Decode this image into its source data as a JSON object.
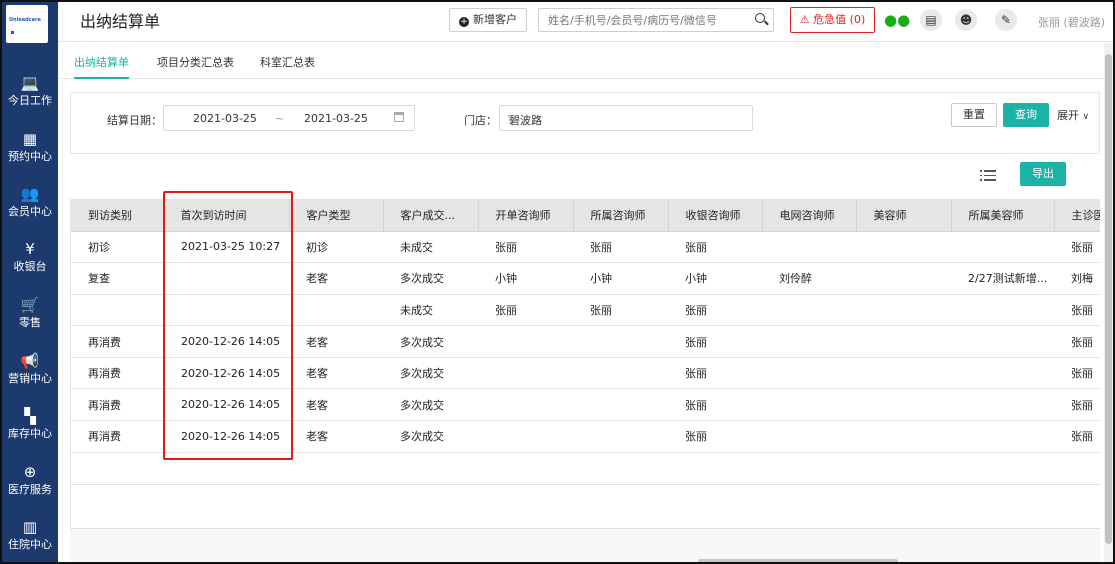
{
  "logo": {
    "text": "Unleadcare"
  },
  "sidebar": {
    "items": [
      {
        "label": "今日工作",
        "icon": "laptop-icon",
        "glyph": "💻"
      },
      {
        "label": "预约中心",
        "icon": "calendar-icon",
        "glyph": "▦"
      },
      {
        "label": "会员中心",
        "icon": "users-icon",
        "glyph": "👥"
      },
      {
        "label": "收银台",
        "icon": "yen-icon",
        "glyph": "¥"
      },
      {
        "label": "零售",
        "icon": "cart-icon",
        "glyph": "🛒"
      },
      {
        "label": "营销中心",
        "icon": "megaphone-icon",
        "glyph": "📢"
      },
      {
        "label": "库存中心",
        "icon": "grid-icon",
        "glyph": "▚"
      },
      {
        "label": "医疗服务",
        "icon": "medkit-icon",
        "glyph": "⊕"
      },
      {
        "label": "住院中心",
        "icon": "building-icon",
        "glyph": "▥"
      }
    ]
  },
  "header": {
    "title": "出纳结算单",
    "new_customer": "新增客户",
    "search_placeholder": "姓名/手机号/会员号/病历号/微信号",
    "danger_button": "危急值",
    "danger_count": "0",
    "user": "张丽 (碧波路)"
  },
  "tabs": [
    {
      "label": "出纳结算单",
      "active": true
    },
    {
      "label": "项目分类汇总表",
      "active": false
    },
    {
      "label": "科室汇总表",
      "active": false
    }
  ],
  "filters": {
    "date_label": "结算日期：",
    "date_start": "2021-03-25",
    "date_sep": "~",
    "date_end": "2021-03-25",
    "store_label": "门店：",
    "store_value": "碧波路",
    "reset": "重置",
    "query": "查询",
    "expand": "展开",
    "export": "导出"
  },
  "table": {
    "columns": [
      "到访类别",
      "首次到访时间",
      "客户类型",
      "客户成交...",
      "开单咨询师",
      "所属咨询师",
      "收银咨询师",
      "电网咨询师",
      "美容师",
      "所属美容师",
      "主诊医"
    ],
    "rows": [
      [
        "初诊",
        "2021-03-25 10:27",
        "初诊",
        "未成交",
        "张丽",
        "张丽",
        "张丽",
        "",
        "",
        "",
        "张丽"
      ],
      [
        "复查",
        "",
        "老客",
        "多次成交",
        "小钟",
        "小钟",
        "小钟",
        "刘伶醉",
        "",
        "2/27测试新增...",
        "刘梅"
      ],
      [
        "",
        "",
        "",
        "未成交",
        "张丽",
        "张丽",
        "张丽",
        "",
        "",
        "",
        "张丽"
      ],
      [
        "再消费",
        "2020-12-26 14:05",
        "老客",
        "多次成交",
        "",
        "",
        "张丽",
        "",
        "",
        "",
        "张丽"
      ],
      [
        "再消费",
        "2020-12-26 14:05",
        "老客",
        "多次成交",
        "",
        "",
        "张丽",
        "",
        "",
        "",
        "张丽"
      ],
      [
        "再消费",
        "2020-12-26 14:05",
        "老客",
        "多次成交",
        "",
        "",
        "张丽",
        "",
        "",
        "",
        "张丽"
      ],
      [
        "再消费",
        "2020-12-26 14:05",
        "老客",
        "多次成交",
        "",
        "",
        "张丽",
        "",
        "",
        "",
        "张丽"
      ]
    ]
  },
  "colors": {
    "sidebar": "#1d3a6e",
    "accent": "#1bb3a6",
    "danger": "#e02020",
    "highlight": "#e01919"
  }
}
